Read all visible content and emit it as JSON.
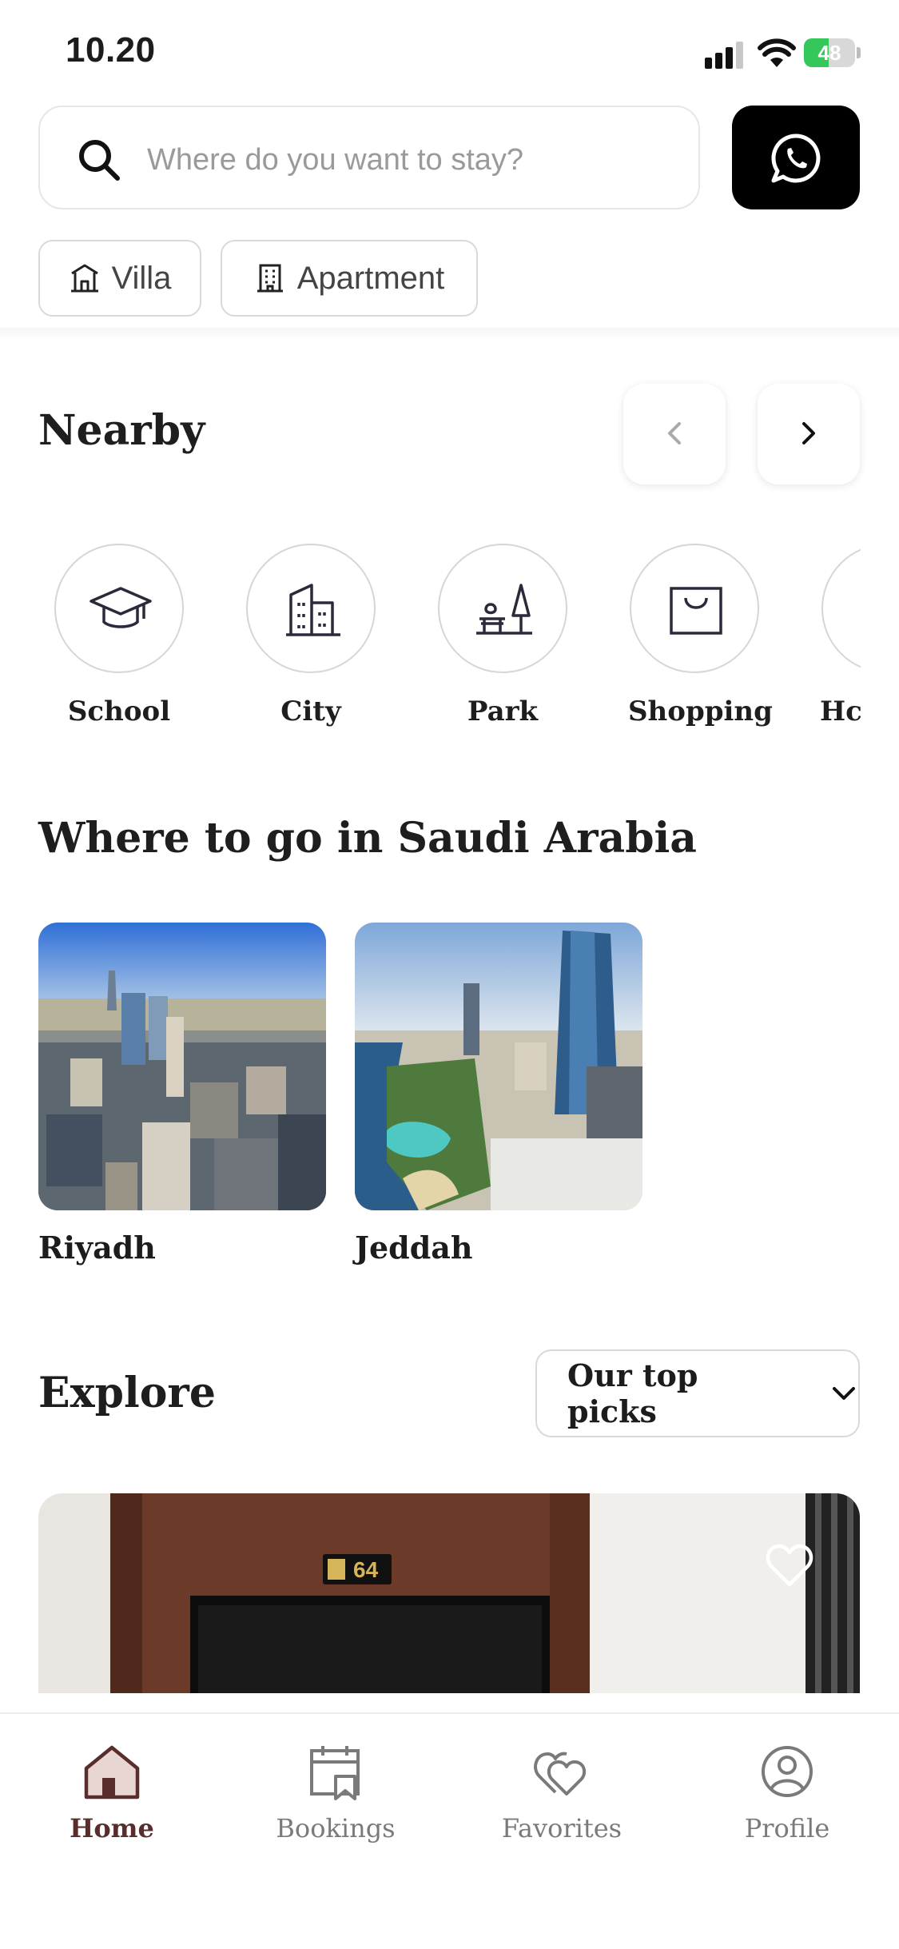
{
  "status_bar": {
    "time": "10.20",
    "battery": "48",
    "battery_level": 0.48
  },
  "search": {
    "placeholder": "Where do you want to stay?",
    "value": ""
  },
  "property_filters": [
    {
      "label": "Villa",
      "icon": "villa-icon"
    },
    {
      "label": "Apartment",
      "icon": "apartment-icon"
    }
  ],
  "nearby": {
    "title": "Nearby",
    "categories": [
      {
        "label": "School",
        "icon": "graduation-cap-icon"
      },
      {
        "label": "City",
        "icon": "buildings-icon"
      },
      {
        "label": "Park",
        "icon": "park-icon"
      },
      {
        "label": "Shopping",
        "icon": "shopping-bag-icon"
      },
      {
        "label": "Hc",
        "icon": "hospital-icon"
      }
    ]
  },
  "destinations": {
    "title": "Where to go in Saudi Arabia",
    "items": [
      {
        "label": "Riyadh"
      },
      {
        "label": "Jeddah"
      }
    ]
  },
  "explore": {
    "title": "Explore",
    "sort_selected": "Our top picks",
    "room_number": "64"
  },
  "tab_bar": {
    "items": [
      {
        "label": "Home",
        "icon": "home-icon",
        "active": true
      },
      {
        "label": "Bookings",
        "icon": "bookings-icon",
        "active": false
      },
      {
        "label": "Favorites",
        "icon": "favorites-icon",
        "active": false
      },
      {
        "label": "Profile",
        "icon": "profile-icon",
        "active": false
      }
    ]
  },
  "colors": {
    "accent": "#5a2d2d",
    "whatsapp_button": "#000000",
    "battery_green": "#34c759"
  }
}
